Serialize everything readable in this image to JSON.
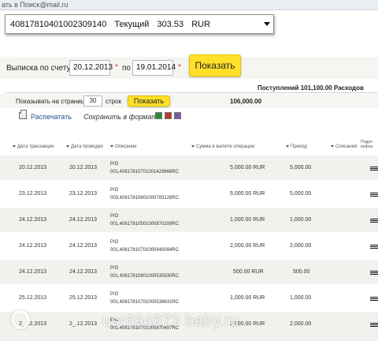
{
  "browser": {
    "bookmark": "ать в Поиск@mail.ru"
  },
  "account": {
    "number": "40817810401002309140",
    "type": "Текущий",
    "balance": "303.53",
    "currency": "RUR"
  },
  "statement": {
    "label_from": "Выписка по счету с",
    "date_from": "20.12.2013",
    "label_to": "по",
    "date_to": "19.01.2014",
    "required_mark": "*",
    "show_button": "Показать"
  },
  "summary": {
    "incoming": "Поступлений 101,100.00",
    "outgoing_label": "Расходов",
    "outgoing_value": "106,000.00"
  },
  "paging": {
    "label": "Показывать на странице",
    "per_page": "30",
    "unit": "строк",
    "show_button": "Показать"
  },
  "actions": {
    "print": "Распечатать",
    "save_format": "Сохранить в формате"
  },
  "formats": [
    {
      "name": "xls-icon",
      "color": "#2e8b3a"
    },
    {
      "name": "csv-icon",
      "color": "#c0392b"
    },
    {
      "name": "txt-icon",
      "color": "#7a5aa8"
    }
  ],
  "table": {
    "headers": {
      "date_tx": "Дата транзакции",
      "date_post": "Дата проводки",
      "desc": "Описание",
      "amount": "Сумма в валюте операции",
      "income": "Приход",
      "debit": "Списания",
      "details": "Подро инфор"
    },
    "rows": [
      {
        "date_tx": "20.12.2013",
        "date_post": "20.12.2013",
        "desc1": "P/O",
        "desc2": "001,40817810701001429666RC",
        "amount": "5,000.00 RUR",
        "income": "5,000.00"
      },
      {
        "date_tx": "23.12.2013",
        "date_post": "23.12.2013",
        "desc1": "P/O",
        "desc2": "003,40817810601000783126RC",
        "amount": "5,000.00 RUR",
        "income": "5,000.00"
      },
      {
        "date_tx": "24.12.2013",
        "date_post": "24.12.2013",
        "desc1": "P/O",
        "desc2": "001,40817810501000870209RC",
        "amount": "1,000.00 RUR",
        "income": "1,000.00"
      },
      {
        "date_tx": "24.12.2013",
        "date_post": "24.12.2013",
        "desc1": "P/O",
        "desc2": "001,40817810701000940094RC",
        "amount": "2,000.00 RUR",
        "income": "2,000.00"
      },
      {
        "date_tx": "24.12.2013",
        "date_post": "24.12.2013",
        "desc1": "P/O",
        "desc2": "001,40817810801000535930RC",
        "amount": "500.00 RUR",
        "income": "500.00"
      },
      {
        "date_tx": "25.12.2013",
        "date_post": "25.12.2013",
        "desc1": "P/O",
        "desc2": "001,40817810701000536631RC",
        "amount": "1,000.00 RUR",
        "income": "1,000.00"
      },
      {
        "date_tx": "2_.12.2013",
        "date_post": "2_.12.2013",
        "desc1": "P/O",
        "desc2": "001,40817810701000870497RC",
        "amount": "2,000.00 RUR",
        "income": "2,000.00"
      }
    ]
  },
  "watermark": "usr694873 baby.ru"
}
